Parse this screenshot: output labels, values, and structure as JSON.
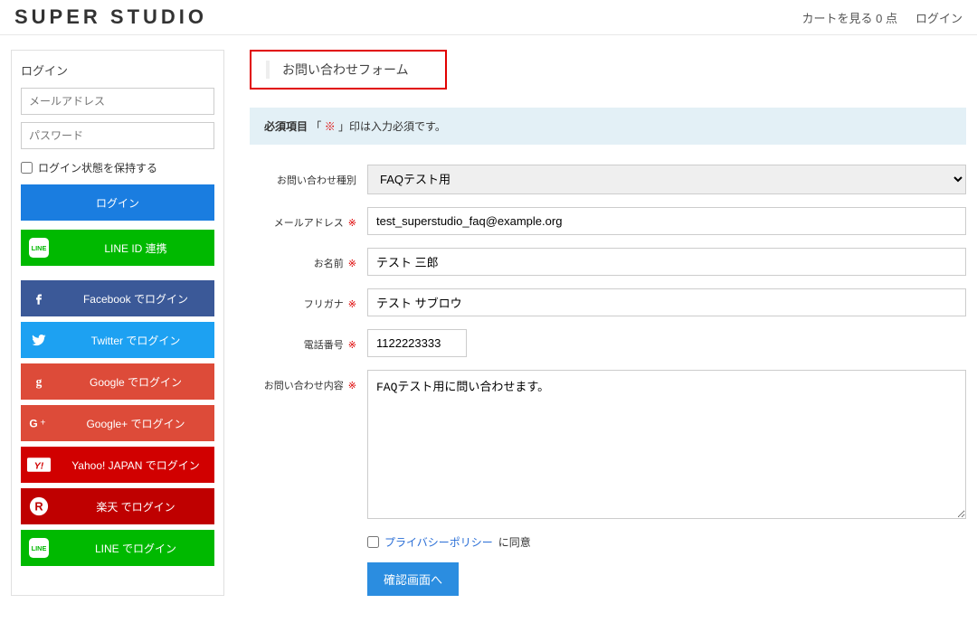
{
  "header": {
    "logo": "SUPER STUDIO",
    "cart_label": "カートを見る 0 点",
    "login_label": "ログイン"
  },
  "sidebar": {
    "title": "ログイン",
    "email_placeholder": "メールアドレス",
    "password_placeholder": "パスワード",
    "keep_label": "ログイン状態を保持する",
    "login_btn": "ログイン",
    "socials": [
      {
        "id": "line-link",
        "label": "LINE ID 連携",
        "class": "btn-green",
        "icon": "line"
      },
      {
        "id": "facebook",
        "label": "Facebook でログイン",
        "class": "btn-fb",
        "icon": "fb"
      },
      {
        "id": "twitter",
        "label": "Twitter でログイン",
        "class": "btn-tw",
        "icon": "tw"
      },
      {
        "id": "google",
        "label": "Google でログイン",
        "class": "btn-gg",
        "icon": "gg"
      },
      {
        "id": "googleplus",
        "label": "Google+ でログイン",
        "class": "btn-gp",
        "icon": "gp"
      },
      {
        "id": "yahoo",
        "label": "Yahoo! JAPAN でログイン",
        "class": "btn-yh",
        "icon": "yh"
      },
      {
        "id": "rakuten",
        "label": "楽天 でログイン",
        "class": "btn-rt",
        "icon": "rt"
      },
      {
        "id": "line-login",
        "label": "LINE でログイン",
        "class": "btn-green",
        "icon": "line"
      }
    ]
  },
  "main": {
    "title": "お問い合わせフォーム",
    "notice_prefix": "必須項目",
    "notice_mark_pre": "「 ",
    "notice_mark": "※",
    "notice_mark_post": " 」印は入力必須です。",
    "fields": {
      "type_label": "お問い合わせ種別",
      "type_value": "FAQテスト用",
      "email_label": "メールアドレス",
      "email_value": "test_superstudio_faq@example.org",
      "name_label": "お名前",
      "name_value": "テスト 三郎",
      "kana_label": "フリガナ",
      "kana_value": "テスト サブロウ",
      "phone_label": "電話番号",
      "phone_value": "1122223333",
      "content_label": "お問い合わせ内容",
      "content_value": "FAQテスト用に問い合わせます。"
    },
    "consent_link": "プライバシーポリシー",
    "consent_suffix": "に同意",
    "submit_label": "確認画面へ"
  }
}
